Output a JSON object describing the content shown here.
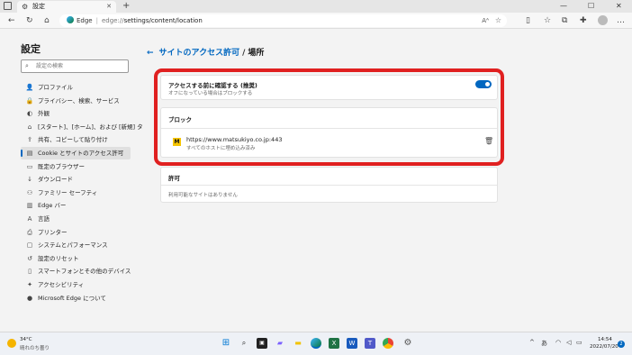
{
  "browser": {
    "tab_title": "設定",
    "address": {
      "label": "Edge",
      "separator": "|",
      "url_prefix": "edge://",
      "url_path": "settings/content/location"
    }
  },
  "sidebar": {
    "title": "設定",
    "search_placeholder": "設定の検索",
    "items": [
      {
        "label": "プロファイル",
        "icon": "profile-icon",
        "glyph": "👤"
      },
      {
        "label": "プライバシー、検索、サービス",
        "icon": "lock-icon",
        "glyph": "🔒"
      },
      {
        "label": "外観",
        "icon": "appearance-icon",
        "glyph": "◐"
      },
      {
        "label": "[スタート]、[ホーム]、および [新規] タブ",
        "icon": "home-icon",
        "glyph": "⌂"
      },
      {
        "label": "共有、コピーして貼り付け",
        "icon": "share-icon",
        "glyph": "⇪"
      },
      {
        "label": "Cookie とサイトのアクセス許可",
        "icon": "cookie-icon",
        "glyph": "▤"
      },
      {
        "label": "既定のブラウザー",
        "icon": "browser-icon",
        "glyph": "▭"
      },
      {
        "label": "ダウンロード",
        "icon": "download-icon",
        "glyph": "↓"
      },
      {
        "label": "ファミリー セーフティ",
        "icon": "family-icon",
        "glyph": "⚇"
      },
      {
        "label": "Edge バー",
        "icon": "edge-bar-icon",
        "glyph": "▥"
      },
      {
        "label": "言語",
        "icon": "language-icon",
        "glyph": "A"
      },
      {
        "label": "プリンター",
        "icon": "printer-icon",
        "glyph": "⎙"
      },
      {
        "label": "システムとパフォーマンス",
        "icon": "system-icon",
        "glyph": "▢"
      },
      {
        "label": "設定のリセット",
        "icon": "reset-icon",
        "glyph": "↺"
      },
      {
        "label": "スマートフォンとその他のデバイス",
        "icon": "phone-icon",
        "glyph": "▯"
      },
      {
        "label": "アクセシビリティ",
        "icon": "accessibility-icon",
        "glyph": "✦"
      },
      {
        "label": "Microsoft Edge について",
        "icon": "edge-icon",
        "glyph": "●"
      }
    ],
    "active_index": 5
  },
  "main": {
    "breadcrumb": {
      "back_glyph": "←",
      "parent": "サイトのアクセス許可",
      "separator": "/",
      "current": "場所"
    },
    "ask_before_access": {
      "title": "アクセスする前に確認する (推奨)",
      "subtitle": "オフになっている場合はブロックする",
      "enabled": true
    },
    "block_section": {
      "heading": "ブロック",
      "site_url": "https://www.matsukiyo.co.jp:443",
      "site_sub": "すべてのホストに埋め込み済み",
      "site_icon_glyph": "M"
    },
    "allow_section": {
      "heading": "許可",
      "empty_text": "利用可能なサイトはありません"
    }
  },
  "taskbar": {
    "weather_temp": "34°C",
    "weather_desc": "晴れのち曇り",
    "ime": "あ",
    "time": "14:54",
    "date": "2022/07/20",
    "notification_count": "2"
  },
  "colors": {
    "accent": "#0067c0",
    "highlight_border": "#e02020",
    "site_icon_bg": "#f5c400"
  }
}
